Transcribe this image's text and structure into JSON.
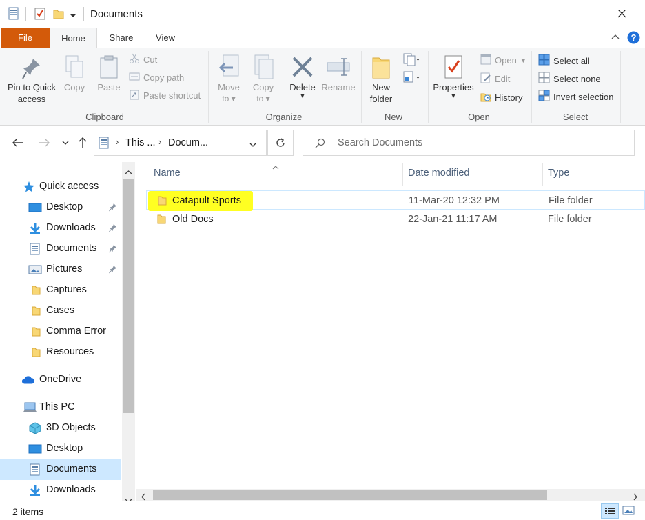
{
  "window": {
    "title": "Documents",
    "minimize_glyph": "—",
    "maximize_glyph": "☐",
    "close_glyph": "✕"
  },
  "ribbon_tabs": {
    "file": "File",
    "home": "Home",
    "share": "Share",
    "view": "View"
  },
  "ribbon": {
    "clipboard": {
      "pin": "Pin to Quick access",
      "pin_line1": "Pin to Quick",
      "pin_line2": "access",
      "copy": "Copy",
      "paste": "Paste",
      "cut": "Cut",
      "copy_path": "Copy path",
      "paste_shortcut": "Paste shortcut",
      "group": "Clipboard"
    },
    "organize": {
      "move_to_1": "Move",
      "move_to_2": "to",
      "copy_to_1": "Copy",
      "copy_to_2": "to",
      "delete": "Delete",
      "rename": "Rename",
      "group": "Organize"
    },
    "new": {
      "new_folder_1": "New",
      "new_folder_2": "folder",
      "group": "New"
    },
    "open": {
      "properties": "Properties",
      "open": "Open",
      "edit": "Edit",
      "history": "History",
      "group": "Open"
    },
    "select": {
      "select_all": "Select all",
      "select_none": "Select none",
      "invert": "Invert selection",
      "group": "Select"
    }
  },
  "address": {
    "crumb1": "This ...",
    "crumb2": "Docum...",
    "search_placeholder": "Search Documents"
  },
  "nav_pane": {
    "quick_access": "Quick access",
    "items": [
      {
        "label": "Desktop",
        "pinned": true,
        "icon": "desktop-icon"
      },
      {
        "label": "Downloads",
        "pinned": true,
        "icon": "downloads-icon"
      },
      {
        "label": "Documents",
        "pinned": true,
        "icon": "documents-icon"
      },
      {
        "label": "Pictures",
        "pinned": true,
        "icon": "pictures-icon"
      },
      {
        "label": "Captures",
        "pinned": false,
        "icon": "folder-icon"
      },
      {
        "label": "Cases",
        "pinned": false,
        "icon": "folder-icon"
      },
      {
        "label": "Comma Error",
        "pinned": false,
        "icon": "folder-icon"
      },
      {
        "label": "Resources",
        "pinned": false,
        "icon": "folder-icon"
      }
    ],
    "onedrive": "OneDrive",
    "this_pc": "This PC",
    "pc_items": [
      {
        "label": "3D Objects",
        "icon": "3d-objects-icon"
      },
      {
        "label": "Desktop",
        "icon": "desktop-icon"
      },
      {
        "label": "Documents",
        "icon": "documents-icon",
        "selected": true
      },
      {
        "label": "Downloads",
        "icon": "downloads-icon"
      }
    ]
  },
  "file_list": {
    "columns": {
      "name": "Name",
      "date": "Date modified",
      "type": "Type"
    },
    "rows": [
      {
        "name": "Catapult Sports",
        "date": "11-Mar-20 12:32 PM",
        "type": "File folder",
        "highlighted": true
      },
      {
        "name": "Old Docs",
        "date": "22-Jan-21 11:17 AM",
        "type": "File folder",
        "highlighted": false
      }
    ]
  },
  "status": {
    "count": "2 items"
  },
  "colors": {
    "file_tab": "#d35a0a",
    "highlight": "#ffff22",
    "selection": "#cde8ff",
    "folder": "#f8d775",
    "accent_blue": "#1e6fd9"
  }
}
